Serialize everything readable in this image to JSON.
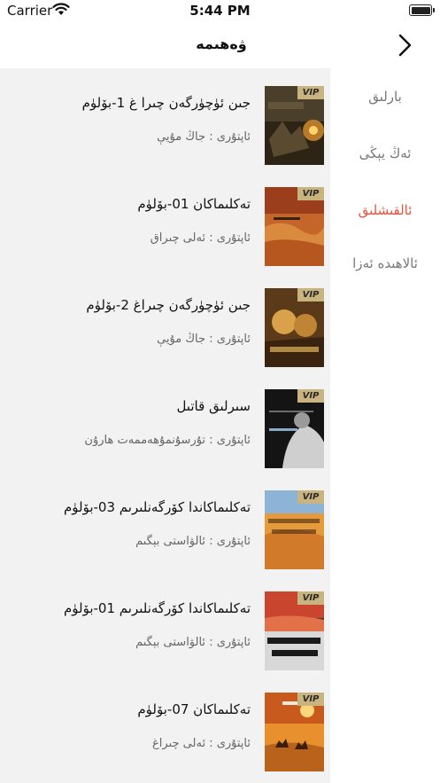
{
  "status_bar": {
    "carrier": "Carrier",
    "time": "5:44 PM"
  },
  "nav": {
    "title": "ۋەھىمە"
  },
  "sidebar": {
    "items": [
      {
        "label": "بارلىق",
        "active": false
      },
      {
        "label": "ئەڭ يېڭى",
        "active": false
      },
      {
        "label": "ئالقىشلىق",
        "active": true
      },
      {
        "label": "ئالاھىدە ئەزا",
        "active": false
      }
    ]
  },
  "badge": "VIP",
  "books": [
    {
      "title": "جىن ئۈچۈرگەن چىرا غ 1-بۆلۈم",
      "author": "ئاپتۇرى : جاڭ مۇيې"
    },
    {
      "title": "تەكلىماكان 01-بۆلۈم",
      "author": "ئاپتۇرى : ئەلى چىراق"
    },
    {
      "title": "جىن ئۈچۈرگەن چىراغ 2-بۆلۈم",
      "author": "ئاپتۇرى : جاڭ مۇيې"
    },
    {
      "title": "سىرلىق قاتىل",
      "author": "ئاپتۇرى : تۇرسۇنمۇھەممەت ھارۇن"
    },
    {
      "title": "تەكلىماكاندا كۆرگەنلىرىم 03-بۆلۈم",
      "author": "ئاپتۇرى : ئالۋاستى بېگىم"
    },
    {
      "title": "تەكلىماكاندا كۆرگەنلىرىم 01-بۆلۈم",
      "author": "ئاپتۇرى : ئالۋاستى بېگىم"
    },
    {
      "title": "تەكلىماكان 07-بۆلۈم",
      "author": "ئاپتۇرى : ئەلى چىراغ"
    }
  ]
}
